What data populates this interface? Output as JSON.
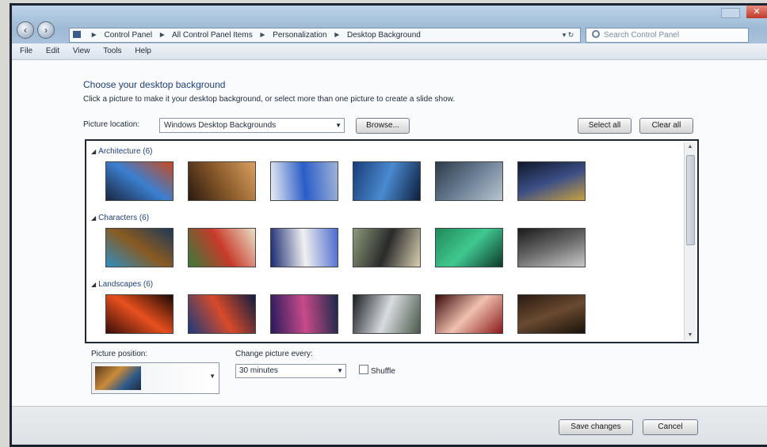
{
  "window": {
    "close_symbol": "✕"
  },
  "nav": {
    "back_symbol": "‹",
    "forward_symbol": "›"
  },
  "address": {
    "segments": [
      "Control Panel",
      "All Control Panel Items",
      "Personalization",
      "Desktop Background"
    ],
    "separator": "►",
    "dropdown_symbol": "▾ ↻"
  },
  "search": {
    "placeholder": "Search Control Panel"
  },
  "menu": {
    "items": [
      "File",
      "Edit",
      "View",
      "Tools",
      "Help"
    ]
  },
  "header": {
    "title": "Choose your desktop background",
    "subtitle": "Click a picture to make it your desktop background, or select more than one picture to create a slide show."
  },
  "picture_location": {
    "label": "Picture location:",
    "value": "Windows Desktop Backgrounds",
    "dropdown_symbol": "▼",
    "browse_label": "Browse..."
  },
  "actions": {
    "select_all_label": "Select all",
    "clear_all_label": "Clear all"
  },
  "groups": [
    {
      "label": "Architecture (6)",
      "thumbs": [
        {
          "name": "architecture-1",
          "colors": [
            "#1a2640",
            "#3b7fd0",
            "#c94a1e"
          ]
        },
        {
          "name": "architecture-2",
          "colors": [
            "#2b1a10",
            "#8a5a2a",
            "#d9a060"
          ]
        },
        {
          "name": "architecture-3",
          "colors": [
            "#e9eef5",
            "#2a5cc8",
            "#9fb4d6"
          ]
        },
        {
          "name": "architecture-4",
          "colors": [
            "#1a3d7a",
            "#4a8ad0",
            "#0e1f3d"
          ]
        },
        {
          "name": "architecture-5",
          "colors": [
            "#2e3a48",
            "#6a7f95",
            "#b9c4cf"
          ]
        },
        {
          "name": "architecture-6",
          "colors": [
            "#10182a",
            "#3a4e86",
            "#c8a040"
          ]
        }
      ]
    },
    {
      "label": "Characters (6)",
      "thumbs": [
        {
          "name": "characters-1",
          "colors": [
            "#2f8fc0",
            "#8a5a20",
            "#1c3a5a"
          ]
        },
        {
          "name": "characters-2",
          "colors": [
            "#3a7a3a",
            "#c83a2a",
            "#e8e0c8"
          ]
        },
        {
          "name": "characters-3",
          "colors": [
            "#1a2a70",
            "#f0f0f0",
            "#4a6ad0"
          ]
        },
        {
          "name": "characters-4",
          "colors": [
            "#8a9a7a",
            "#2a2a2a",
            "#d8d0b0"
          ]
        },
        {
          "name": "characters-5",
          "colors": [
            "#1f8a5a",
            "#40c890",
            "#0e3a2a"
          ]
        },
        {
          "name": "characters-6",
          "colors": [
            "#1a1a1a",
            "#6a6a6a",
            "#c8c8c8"
          ]
        }
      ]
    },
    {
      "label": "Landscapes (6)",
      "thumbs": [
        {
          "name": "landscapes-1",
          "colors": [
            "#3a0e08",
            "#e8501e",
            "#1a0a06"
          ]
        },
        {
          "name": "landscapes-2",
          "colors": [
            "#1a3a7a",
            "#d84a2a",
            "#0e1e40"
          ]
        },
        {
          "name": "landscapes-3",
          "colors": [
            "#2a1a5a",
            "#c84a8a",
            "#1a2a4a"
          ]
        },
        {
          "name": "landscapes-4",
          "colors": [
            "#1a1e22",
            "#d8dce0",
            "#4a5a4a"
          ]
        },
        {
          "name": "landscapes-5",
          "colors": [
            "#3a0a0a",
            "#f0c0b0",
            "#8a1a1a"
          ]
        },
        {
          "name": "landscapes-6",
          "colors": [
            "#2a1a10",
            "#6a4a30",
            "#1a120a"
          ]
        }
      ]
    }
  ],
  "picture_position": {
    "label": "Picture position:",
    "dropdown_symbol": "▼"
  },
  "interval": {
    "label": "Change picture every:",
    "value": "30 minutes",
    "dropdown_symbol": "▼",
    "shuffle_label": "Shuffle"
  },
  "footer": {
    "save_label": "Save changes",
    "cancel_label": "Cancel"
  }
}
